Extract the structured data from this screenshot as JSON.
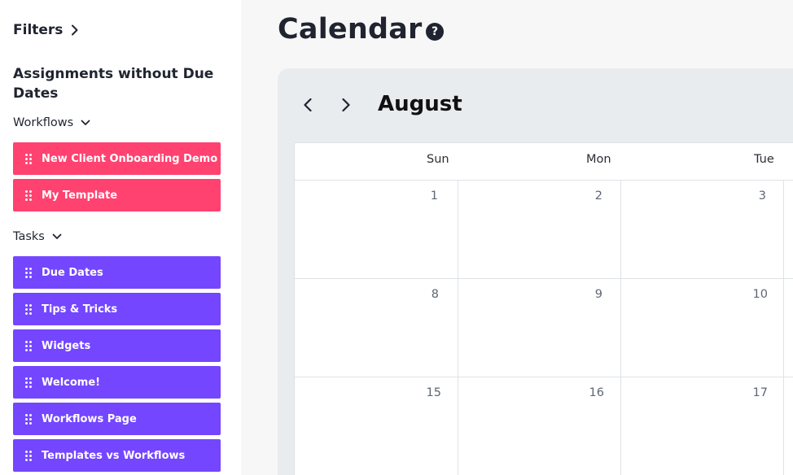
{
  "sidebar": {
    "filters_label": "Filters",
    "section_title": "Assignments without Due Dates",
    "workflows": {
      "label": "Workflows",
      "items": [
        "New Client Onboarding Demo",
        "My Template"
      ]
    },
    "tasks": {
      "label": "Tasks",
      "items": [
        "Due Dates",
        "Tips & Tricks",
        "Widgets",
        "Welcome!",
        "Workflows Page",
        "Templates vs Workflows"
      ]
    }
  },
  "main": {
    "title": "Calendar",
    "help_icon_glyph": "?",
    "month": "August",
    "weekdays": [
      "Sun",
      "Mon",
      "Tue"
    ],
    "weeks": [
      [
        "1",
        "2",
        "3"
      ],
      [
        "8",
        "9",
        "10"
      ],
      [
        "15",
        "16",
        "17"
      ]
    ]
  },
  "colors": {
    "workflow_item": "#ff4270",
    "task_item": "#7446ff",
    "sidebar_bg": "#ffffff",
    "page_bg": "#f7f7f7",
    "calendar_panel": "#e9ecef"
  }
}
